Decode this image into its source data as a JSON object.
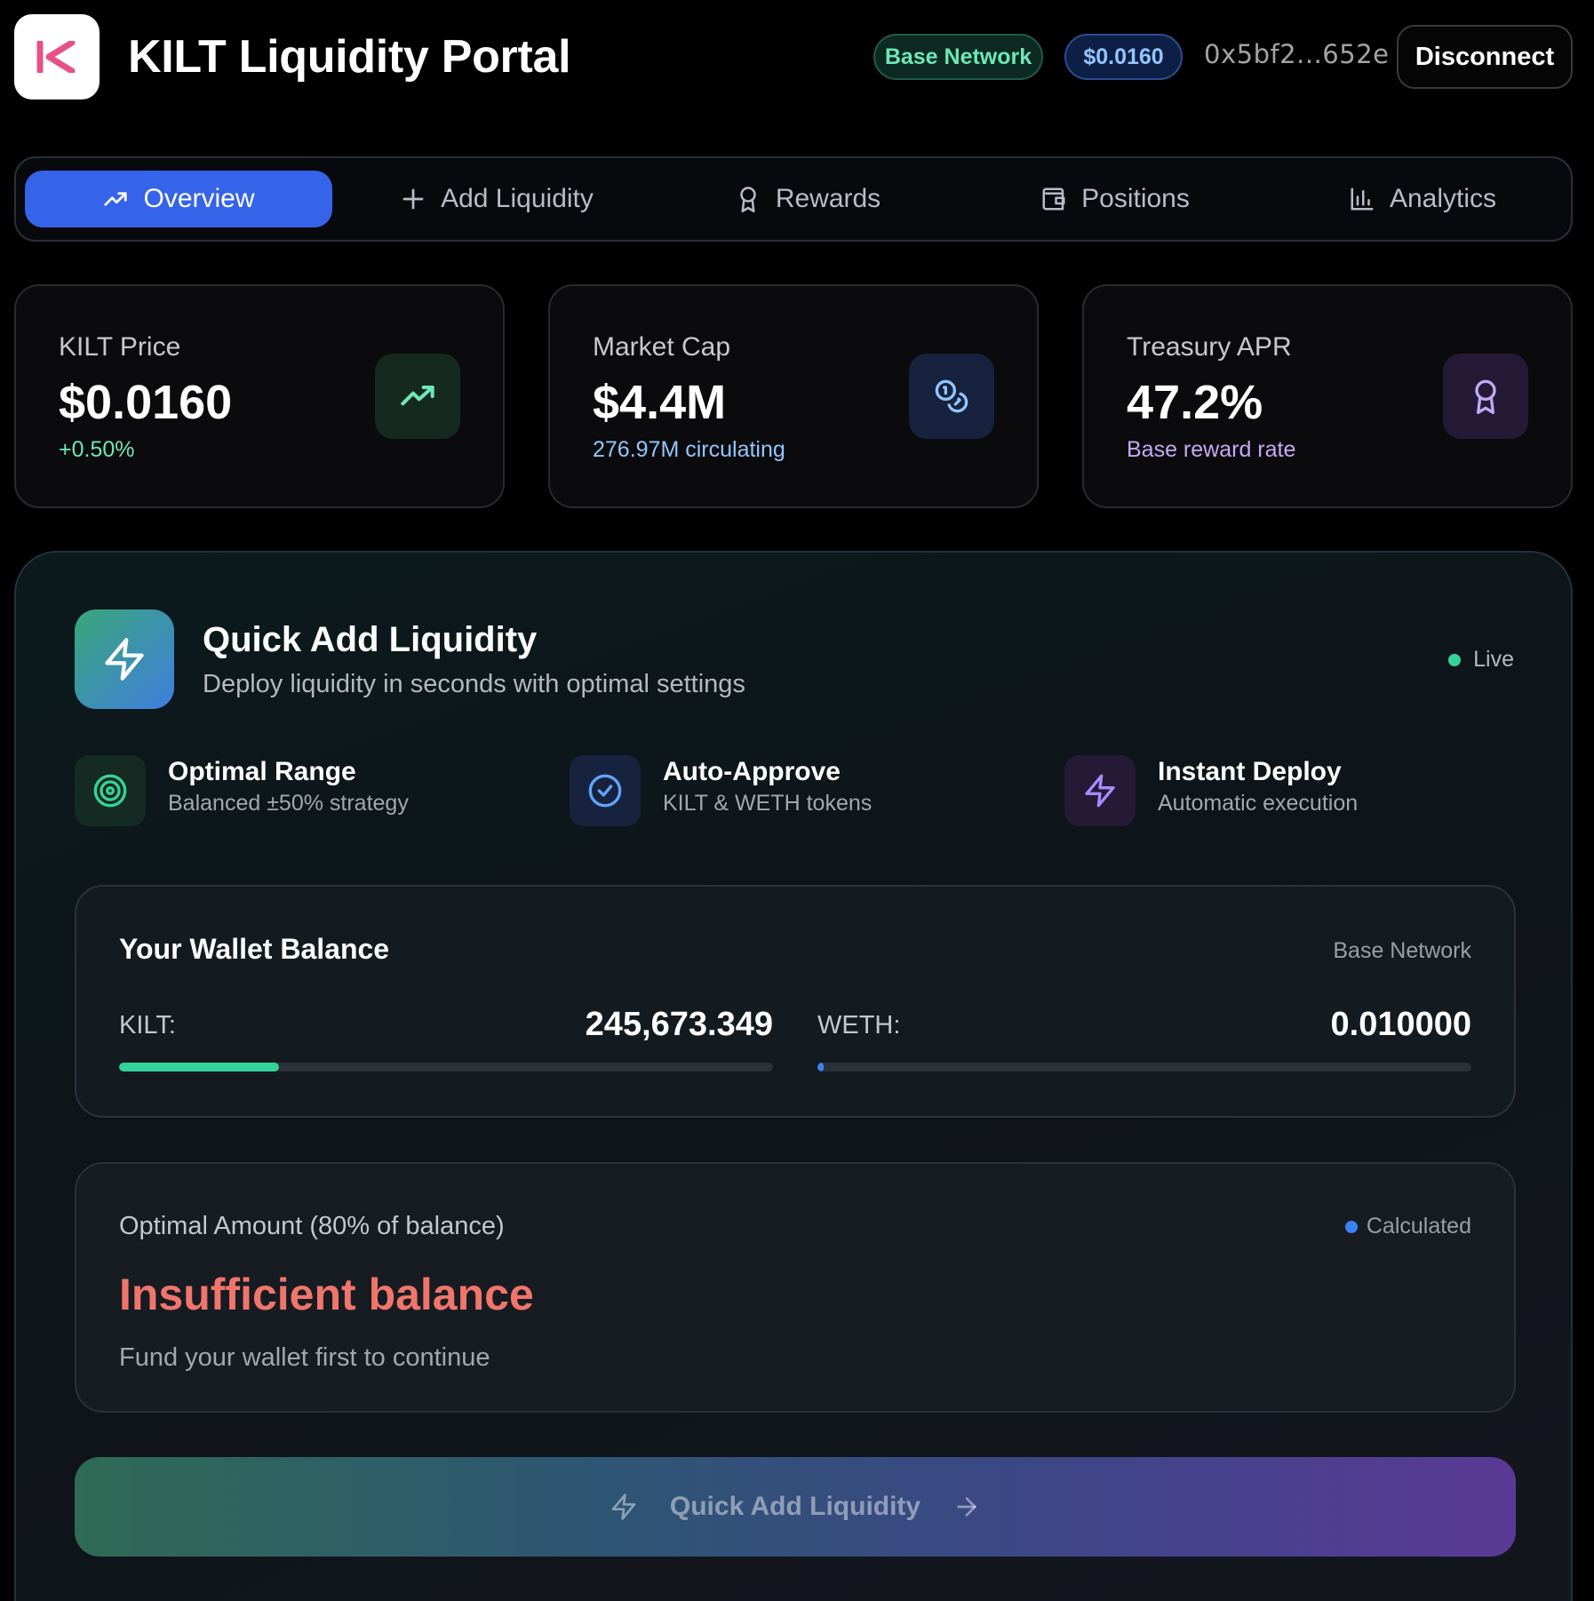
{
  "header": {
    "title": "KILT Liquidity Portal",
    "network_badge": "Base Network",
    "price_badge": "$0.0160",
    "address": "0x5bf2...652e",
    "disconnect_label": "Disconnect"
  },
  "tabs": [
    {
      "label": "Overview",
      "icon": "trending-up-icon",
      "active": true
    },
    {
      "label": "Add Liquidity",
      "icon": "plus-icon",
      "active": false
    },
    {
      "label": "Rewards",
      "icon": "award-icon",
      "active": false
    },
    {
      "label": "Positions",
      "icon": "wallet-icon",
      "active": false
    },
    {
      "label": "Analytics",
      "icon": "bar-chart-icon",
      "active": false
    }
  ],
  "stats": [
    {
      "label": "KILT Price",
      "value": "$0.0160",
      "sub": "+0.50%",
      "icon": "trending-up-icon"
    },
    {
      "label": "Market Cap",
      "value": "$4.4M",
      "sub": "276.97M circulating",
      "icon": "coins-icon"
    },
    {
      "label": "Treasury APR",
      "value": "47.2%",
      "sub": "Base reward rate",
      "icon": "award-icon"
    }
  ],
  "quick_add": {
    "title": "Quick Add Liquidity",
    "subtitle": "Deploy liquidity in seconds with optimal settings",
    "live_label": "Live",
    "features": [
      {
        "title": "Optimal Range",
        "sub": "Balanced ±50% strategy",
        "icon": "target-icon"
      },
      {
        "title": "Auto-Approve",
        "sub": "KILT & WETH tokens",
        "icon": "check-circle-icon"
      },
      {
        "title": "Instant Deploy",
        "sub": "Automatic execution",
        "icon": "zap-icon"
      }
    ],
    "wallet": {
      "title": "Your Wallet Balance",
      "network": "Base Network",
      "kilt_label": "KILT:",
      "kilt_value": "245,673.349",
      "kilt_fill_fraction": 0.245,
      "weth_label": "WETH:",
      "weth_value": "0.010000",
      "weth_fill_fraction": 0.01
    },
    "optimal": {
      "label": "Optimal Amount (80% of balance)",
      "status": "Calculated",
      "main": "Insufficient balance",
      "hint": "Fund your wallet first to continue"
    },
    "cta_label": "Quick Add Liquidity"
  },
  "colors": {
    "accent_blue": "#3563e9",
    "positive_green": "#6ee7b7",
    "error_red": "#f0756b",
    "purple": "#c4a8f5"
  }
}
